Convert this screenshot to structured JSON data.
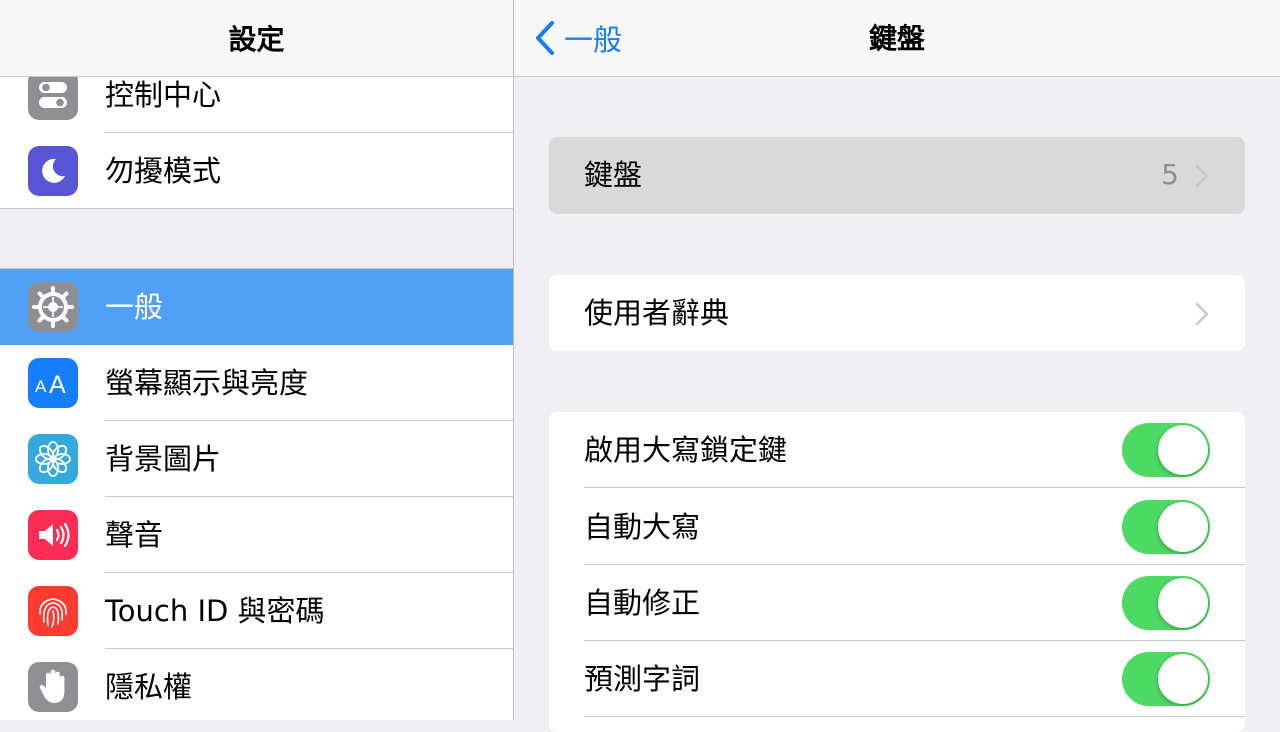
{
  "sidebar": {
    "title": "設定",
    "items": [
      {
        "label": "控制中心",
        "icon": "control-center-icon",
        "color": "#8e8e93"
      },
      {
        "label": "勿擾模式",
        "icon": "moon-icon",
        "color": "#5856d6"
      },
      {
        "label": "一般",
        "icon": "gear-icon",
        "color": "#8e8e93",
        "selected": true
      },
      {
        "label": "螢幕顯示與亮度",
        "icon": "text-size-icon",
        "color": "#157efb"
      },
      {
        "label": "背景圖片",
        "icon": "flower-icon",
        "color": "#34aadc"
      },
      {
        "label": "聲音",
        "icon": "speaker-icon",
        "color": "#ff2d55"
      },
      {
        "label": "Touch ID 與密碼",
        "icon": "fingerprint-icon",
        "color": "#ff3b30"
      },
      {
        "label": "隱私權",
        "icon": "hand-icon",
        "color": "#8e8e93"
      }
    ]
  },
  "detail": {
    "back_label": "一般",
    "title": "鍵盤",
    "keyboards_row": {
      "label": "鍵盤",
      "value": "5"
    },
    "dictionary_row": {
      "label": "使用者辭典"
    },
    "toggles": [
      {
        "label": "啟用大寫鎖定鍵",
        "on": true
      },
      {
        "label": "自動大寫",
        "on": true
      },
      {
        "label": "自動修正",
        "on": true
      },
      {
        "label": "預測字詞",
        "on": true
      }
    ]
  },
  "colors": {
    "accent": "#157efb",
    "selected_row": "#51a0f7",
    "toggle_on": "#4cd964"
  }
}
